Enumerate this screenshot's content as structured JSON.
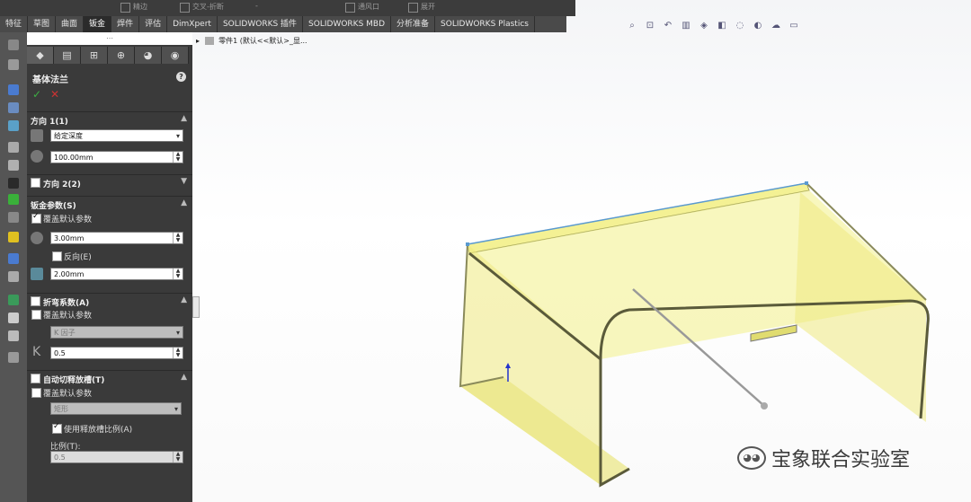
{
  "top_strip": {
    "items": [
      "精边",
      "交叉-折断",
      "-",
      "通风口",
      "展开"
    ]
  },
  "command_tabs": [
    "特征",
    "草图",
    "曲面",
    "钣金",
    "焊件",
    "评估",
    "DimXpert",
    "SOLIDWORKS 插件",
    "SOLIDWORKS MBD",
    "分析准备",
    "SOLIDWORKS Plastics"
  ],
  "active_tab": "钣金",
  "feature_tree": {
    "arrow": "▸",
    "text": "零件1  (默认<<默认>_显..."
  },
  "panel": {
    "top_dots": "⋯",
    "title": "基体法兰",
    "help": "?",
    "ok": "✓",
    "cancel": "✕",
    "direction1": {
      "label": "方向 1(1)",
      "end_condition": "给定深度",
      "depth": "100.00mm"
    },
    "direction2": {
      "label": "方向 2(2)"
    },
    "sheet_metal": {
      "label": "钣金参数(S)",
      "override_label": "覆盖默认参数",
      "thickness": "3.00mm",
      "reverse_label": "反向(E)",
      "radius": "2.00mm"
    },
    "bend_allowance": {
      "label": "折弯系数(A)",
      "override_label": "覆盖默认参数",
      "type": "K 因子",
      "k_value": "0.5",
      "k_symbol": "K"
    },
    "auto_relief": {
      "label": "自动切释放槽(T)",
      "override_label": "覆盖默认参数",
      "type": "矩形",
      "use_ratio_label": "使用释放槽比例(A)",
      "ratio_label": "比例(T):",
      "ratio_value": "0.5"
    }
  },
  "headsup_icons": [
    "zoom-fit-icon",
    "zoom-area-icon",
    "previous-view-icon",
    "section-view-icon",
    "view-orientation-icon",
    "display-style-icon",
    "hide-show-icon",
    "edit-appearance-icon",
    "scene-icon",
    "view-settings-icon"
  ],
  "watermark": "宝象联合实验室",
  "colors": {
    "panel_bg": "#3a3a3a",
    "tab_bg": "#4a4a4a",
    "part_yellow": "#f3f089",
    "edge": "#5a5a3a"
  }
}
